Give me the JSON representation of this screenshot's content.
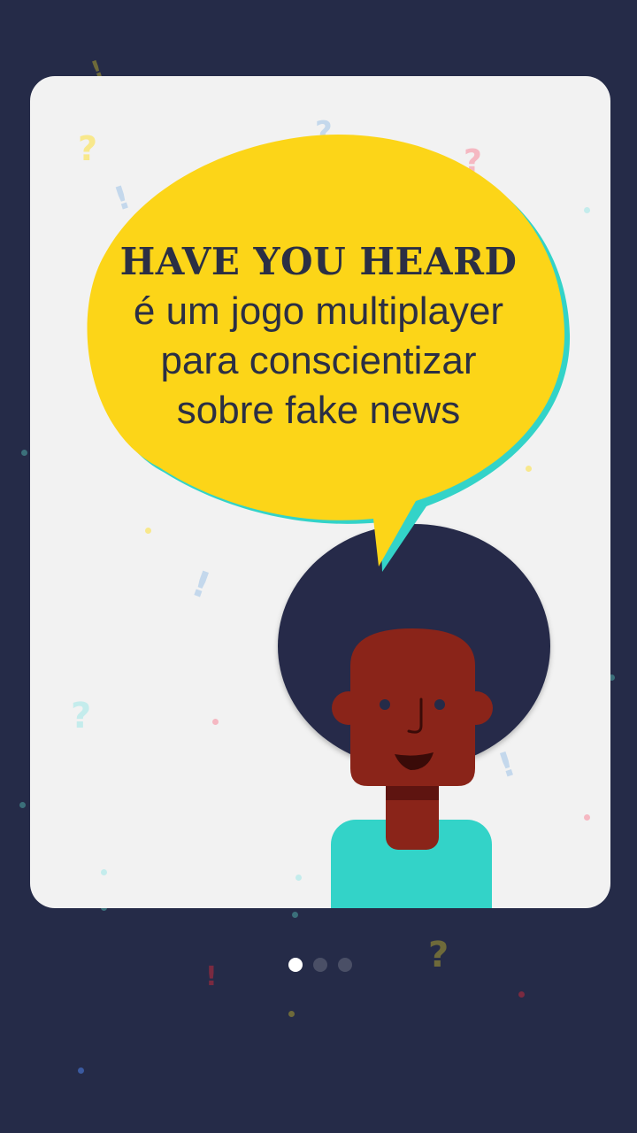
{
  "slide": {
    "title": "HAVE YOU HEARD",
    "lines": [
      "é um jogo multiplayer",
      "para conscientizar",
      "sobre fake news"
    ]
  },
  "pager": {
    "count": 3,
    "active": 1
  },
  "colors": {
    "background": "#252b48",
    "card": "#f2f2f2",
    "bubble": "#fcd518",
    "bubble_shadow": "#33d3c8",
    "hair": "#252b48",
    "skin": "#8a2419",
    "shirt": "#33d3c8",
    "text": "#2b2f44"
  },
  "decorations": {
    "question_mark": "?",
    "exclamation_mark": "!"
  },
  "icons": [
    "character-illustration",
    "speech-bubble",
    "confetti-question-marks"
  ]
}
